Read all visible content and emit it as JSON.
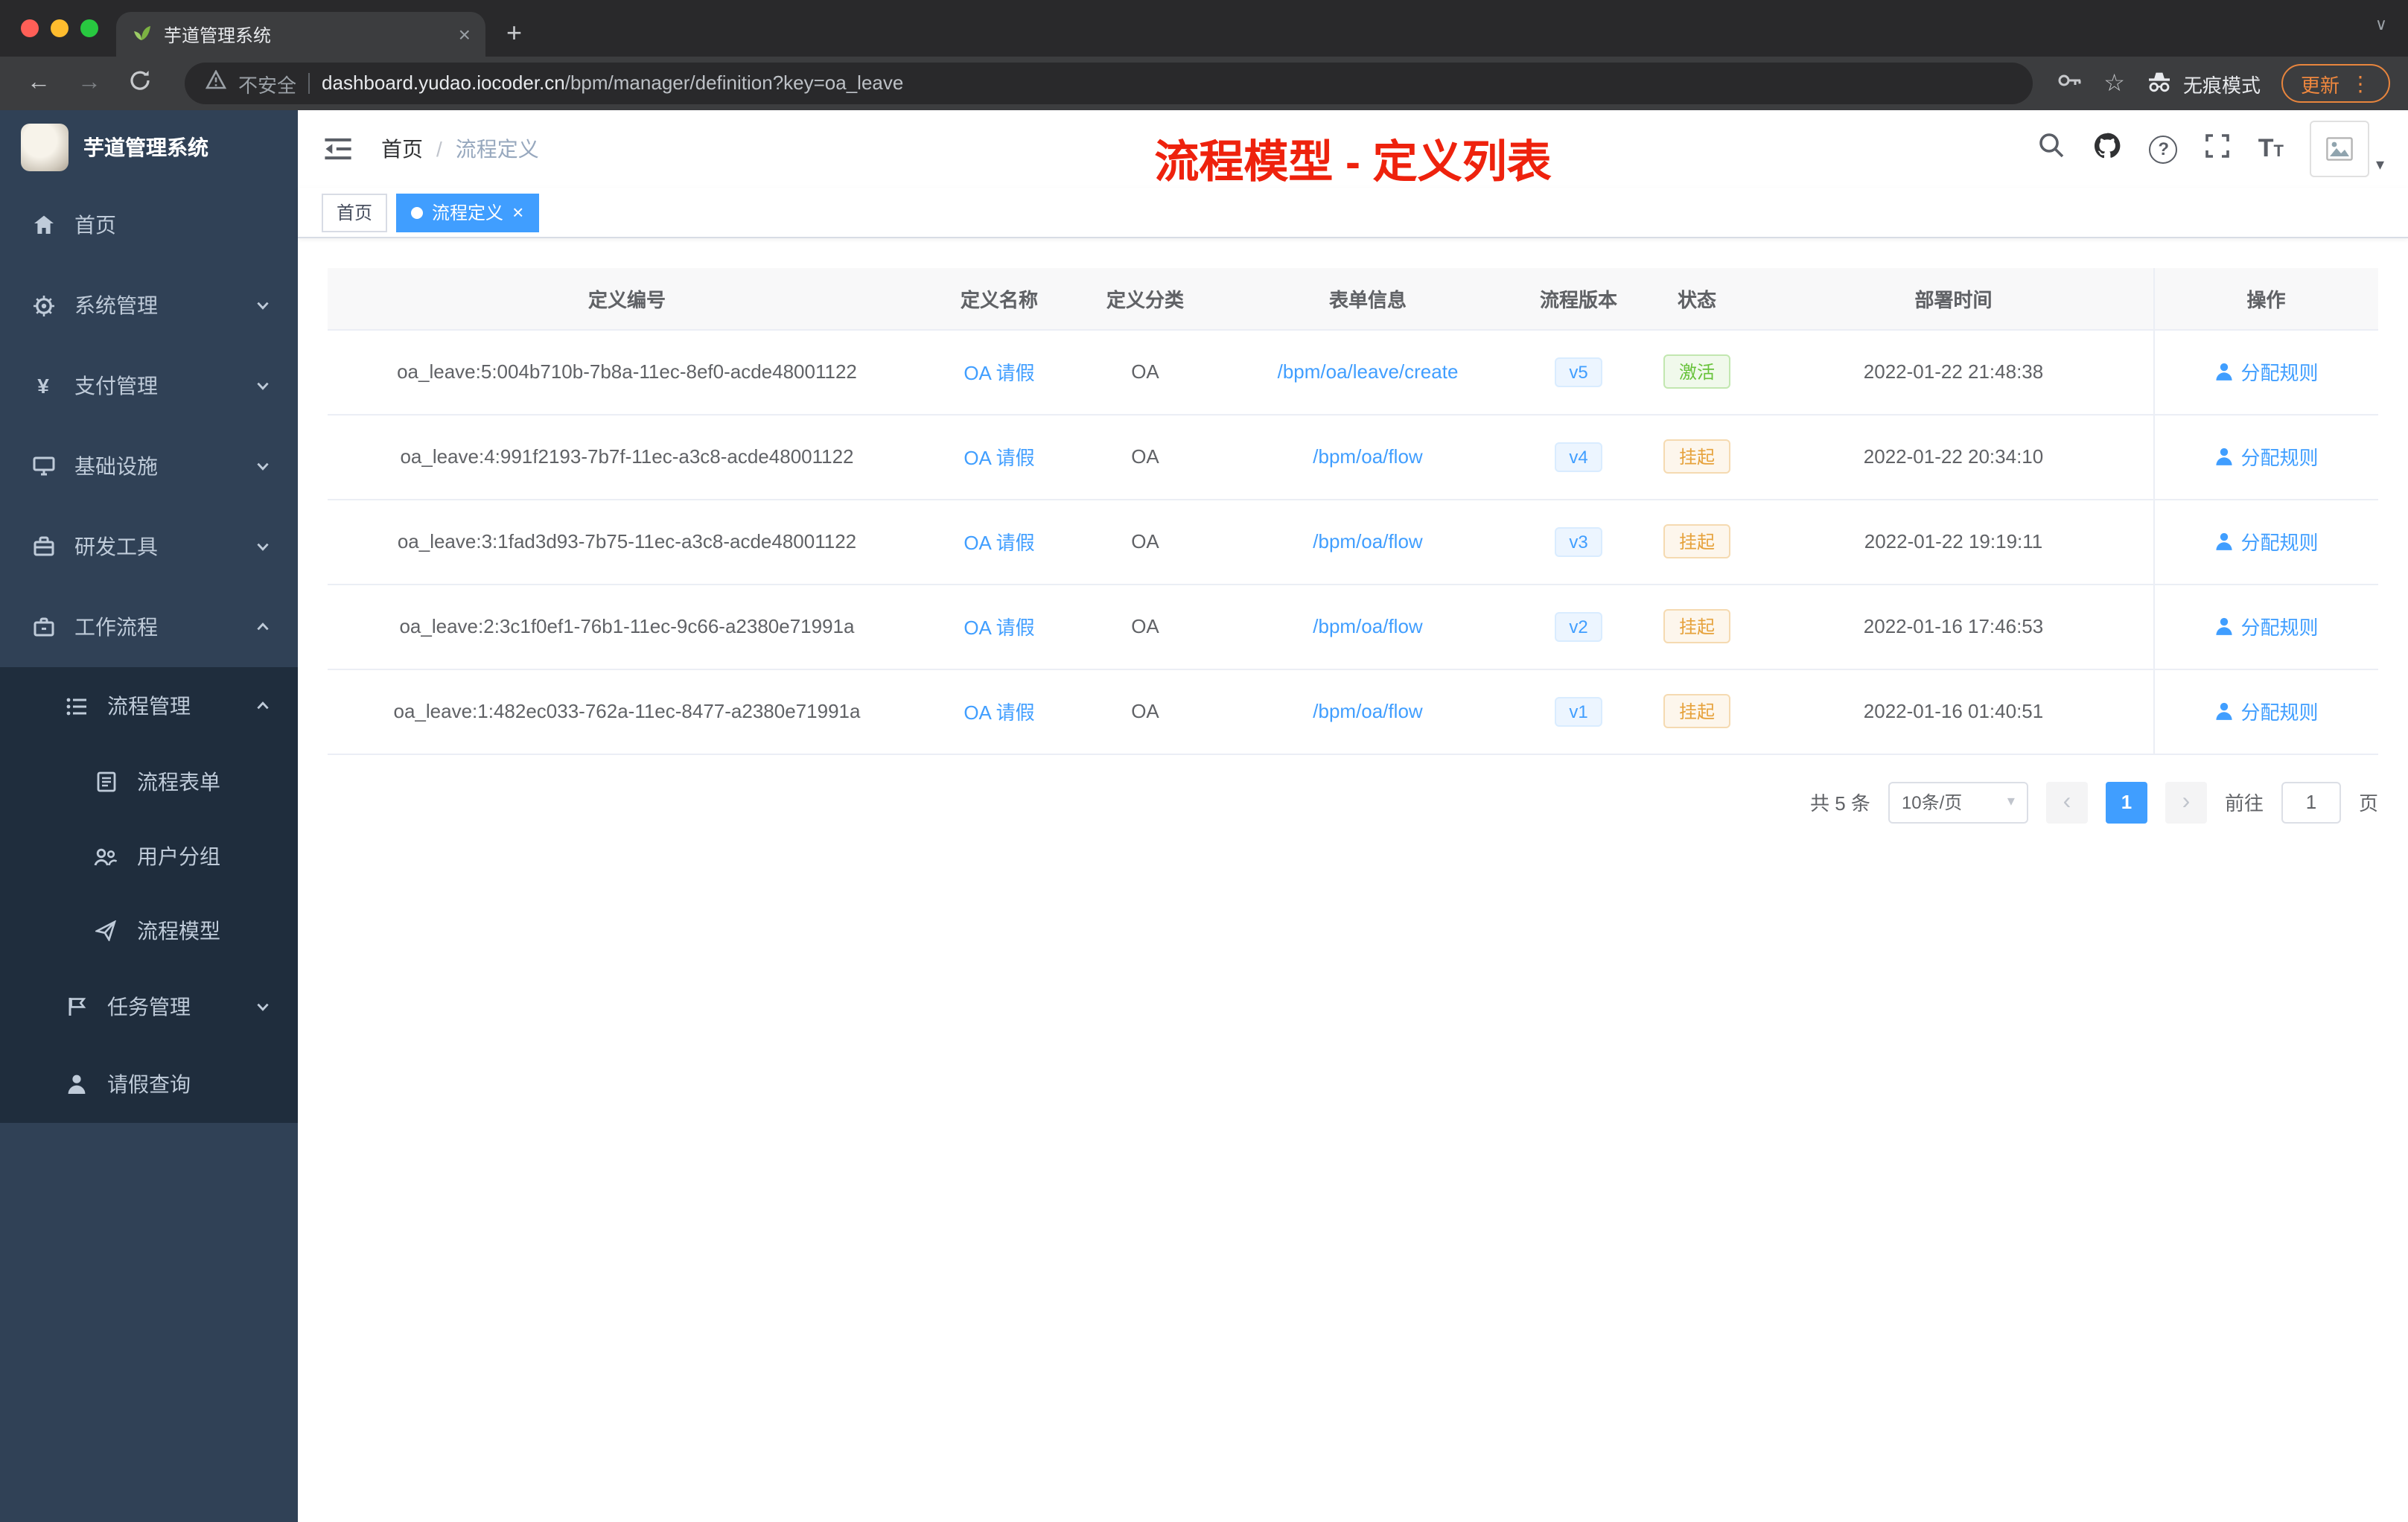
{
  "browser": {
    "tab_title": "芋道管理系统",
    "security_label": "不安全",
    "url_host": "dashboard.yudao.iocoder.cn",
    "url_path": "/bpm/manager/definition?key=oa_leave",
    "incognito_label": "无痕模式",
    "update_label": "更新"
  },
  "sidebar": {
    "app_title": "芋道管理系统",
    "items": [
      {
        "label": "首页",
        "icon": "home-icon"
      },
      {
        "label": "系统管理",
        "icon": "gear-icon"
      },
      {
        "label": "支付管理",
        "icon": "yen-icon"
      },
      {
        "label": "基础设施",
        "icon": "monitor-icon"
      },
      {
        "label": "研发工具",
        "icon": "toolbox-icon"
      },
      {
        "label": "工作流程",
        "icon": "briefcase-icon"
      },
      {
        "label": "流程管理",
        "icon": "tree-list-icon"
      },
      {
        "label": "流程表单",
        "icon": "document-icon"
      },
      {
        "label": "用户分组",
        "icon": "users-icon"
      },
      {
        "label": "流程模型",
        "icon": "send-icon"
      },
      {
        "label": "任务管理",
        "icon": "flag-icon"
      },
      {
        "label": "请假查询",
        "icon": "person-icon"
      }
    ]
  },
  "navbar": {
    "breadcrumb": [
      "首页",
      "流程定义"
    ],
    "breadcrumb_separator": "/",
    "annotation": "流程模型 - 定义列表"
  },
  "tags": [
    {
      "label": "首页",
      "active": false
    },
    {
      "label": "流程定义",
      "active": true
    }
  ],
  "table": {
    "headers": [
      "定义编号",
      "定义名称",
      "定义分类",
      "表单信息",
      "流程版本",
      "状态",
      "部署时间",
      "操作"
    ],
    "rows": [
      {
        "id": "oa_leave:5:004b710b-7b8a-11ec-8ef0-acde48001122",
        "name": "OA 请假",
        "category": "OA",
        "form": "/bpm/oa/leave/create",
        "version": "v5",
        "status": "激活",
        "status_type": "success",
        "deploy_time": "2022-01-22 21:48:38",
        "action": "分配规则"
      },
      {
        "id": "oa_leave:4:991f2193-7b7f-11ec-a3c8-acde48001122",
        "name": "OA 请假",
        "category": "OA",
        "form": "/bpm/oa/flow",
        "version": "v4",
        "status": "挂起",
        "status_type": "warning",
        "deploy_time": "2022-01-22 20:34:10",
        "action": "分配规则"
      },
      {
        "id": "oa_leave:3:1fad3d93-7b75-11ec-a3c8-acde48001122",
        "name": "OA 请假",
        "category": "OA",
        "form": "/bpm/oa/flow",
        "version": "v3",
        "status": "挂起",
        "status_type": "warning",
        "deploy_time": "2022-01-22 19:19:11",
        "action": "分配规则"
      },
      {
        "id": "oa_leave:2:3c1f0ef1-76b1-11ec-9c66-a2380e71991a",
        "name": "OA 请假",
        "category": "OA",
        "form": "/bpm/oa/flow",
        "version": "v2",
        "status": "挂起",
        "status_type": "warning",
        "deploy_time": "2022-01-16 17:46:53",
        "action": "分配规则"
      },
      {
        "id": "oa_leave:1:482ec033-762a-11ec-8477-a2380e71991a",
        "name": "OA 请假",
        "category": "OA",
        "form": "/bpm/oa/flow",
        "version": "v1",
        "status": "挂起",
        "status_type": "warning",
        "deploy_time": "2022-01-16 01:40:51",
        "action": "分配规则"
      }
    ]
  },
  "pagination": {
    "total_label": "共 5 条",
    "page_size_label": "10条/页",
    "current_page": "1",
    "goto_label": "前往",
    "page_unit": "页",
    "goto_value": "1"
  },
  "theme": {
    "accent_blue": "#409eff",
    "success_green": "#67c23a",
    "warning_orange": "#e6a23c",
    "annotation_red": "#ee220d",
    "sidebar_bg": "#304156",
    "sidebar_submenu_bg": "#1f2d3d",
    "update_chip_orange": "#f0883e"
  }
}
